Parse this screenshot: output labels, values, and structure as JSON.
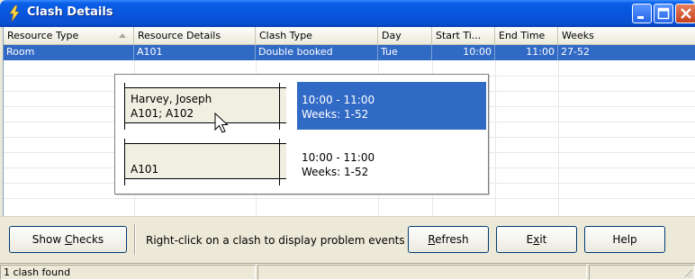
{
  "window": {
    "title": "Clash Details",
    "icon": "lightning-person-icon",
    "controls": [
      "minimize-icon",
      "maximize-icon",
      "close-icon"
    ]
  },
  "grid": {
    "columns": [
      "Resource Type",
      "Resource Details",
      "Clash Type",
      "Day",
      "Start Ti...",
      "End Time",
      "Weeks"
    ],
    "sorted_column": "Resource Type",
    "rows": [
      {
        "resource_type": "Room",
        "resource_details": "A101",
        "clash_type": "Double booked",
        "day": "Tue",
        "start_time": "10:00",
        "end_time": "11:00",
        "weeks": "27-52"
      }
    ]
  },
  "popup": {
    "events": [
      {
        "line1": "Harvey, Joseph",
        "line2": "A101; A102",
        "time": "10:00 - 11:00",
        "weeks": "Weeks: 1-52",
        "selected": true
      },
      {
        "line1": "",
        "line2": "A101",
        "time": "10:00 - 11:00",
        "weeks": "Weeks: 1-52",
        "selected": false
      }
    ]
  },
  "toolbar": {
    "show_checks_prefix": "Show ",
    "show_checks_accel": "C",
    "show_checks_suffix": "hecks",
    "hint": "Right-click on a clash to display problem events",
    "refresh_accel": "R",
    "refresh_suffix": "efresh",
    "exit_prefix": "E",
    "exit_accel": "x",
    "exit_suffix": "it",
    "help_label": "Help"
  },
  "status": {
    "message": "1 clash found"
  },
  "colors": {
    "selection": "#316ac5",
    "titlebar": "#0855dd",
    "panel": "#ece9d8"
  }
}
